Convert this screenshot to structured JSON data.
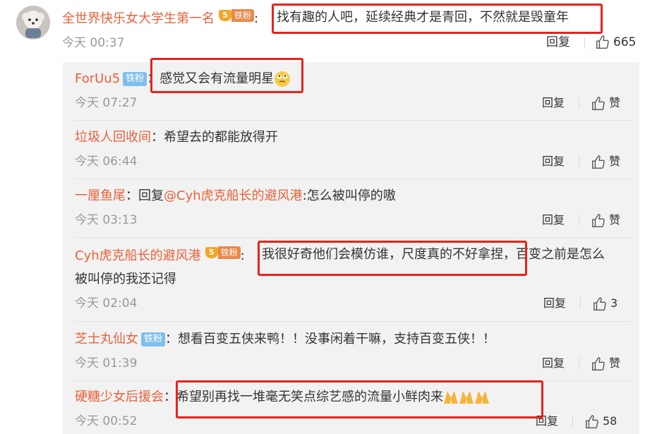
{
  "main": {
    "username": "全世界快乐女大学生第一名",
    "badge_level": "5",
    "badge_fan": "铁粉",
    "separator": ":",
    "text": "找有趣的人吧，延续经典才是青回，不然就是毁童年",
    "time": "今天 00:37",
    "reply_label": "回复",
    "like_count": "665"
  },
  "replies": [
    {
      "username": "ForUu5",
      "badge": "铁粉",
      "separator": "：",
      "text": "感觉又会有流量明星",
      "emoji": "eyes-rolling-emoji",
      "time": "今天 07:27",
      "reply_label": "回复",
      "like_label": "赞"
    },
    {
      "username": "垃圾人回收间",
      "separator": "：",
      "text": "希望去的都能放得开",
      "time": "今天 06:44",
      "reply_label": "回复",
      "like_label": "赞"
    },
    {
      "username": "一厘鱼尾",
      "separator": "：",
      "reply_prefix": "回复",
      "mention": "@Cyh虎克船长的避风港",
      "text": ":怎么被叫停的嗷",
      "time": "今天 03:13",
      "reply_label": "回复",
      "like_label": "赞"
    },
    {
      "username": "Cyh虎克船长的避风港",
      "badge_level": "5",
      "badge_fan": "铁粉",
      "separator": ":",
      "text_line1": "我很好奇他们会模仿谁，尺度真的不好拿捏，百变之前是怎么",
      "text_line2": "被叫停的我还记得",
      "time": "今天 02:04",
      "reply_label": "回复",
      "like_label": "3"
    },
    {
      "username": "芝士丸仙女",
      "badge": "铁粉",
      "separator": "：",
      "text": "想看百变五侠来鸭！！没事闲着干嘛，支持百变五侠！！",
      "time": "今天 01:39",
      "reply_label": "回复",
      "like_label": "赞"
    },
    {
      "username": "硬糖少女后援会",
      "separator": "：",
      "text": "希望别再找一堆毫无笑点综艺感的流量小鲜肉来",
      "emoji": "praying-hands-emoji",
      "time": "今天 00:52",
      "reply_label": "回复",
      "like_label": "58"
    }
  ],
  "colors": {
    "username": "#e8613a",
    "meta": "#999999",
    "reply_bg": "#f2f2f2",
    "highlight_box": "#e8231a",
    "fan_badge": "#7fbfeb"
  }
}
